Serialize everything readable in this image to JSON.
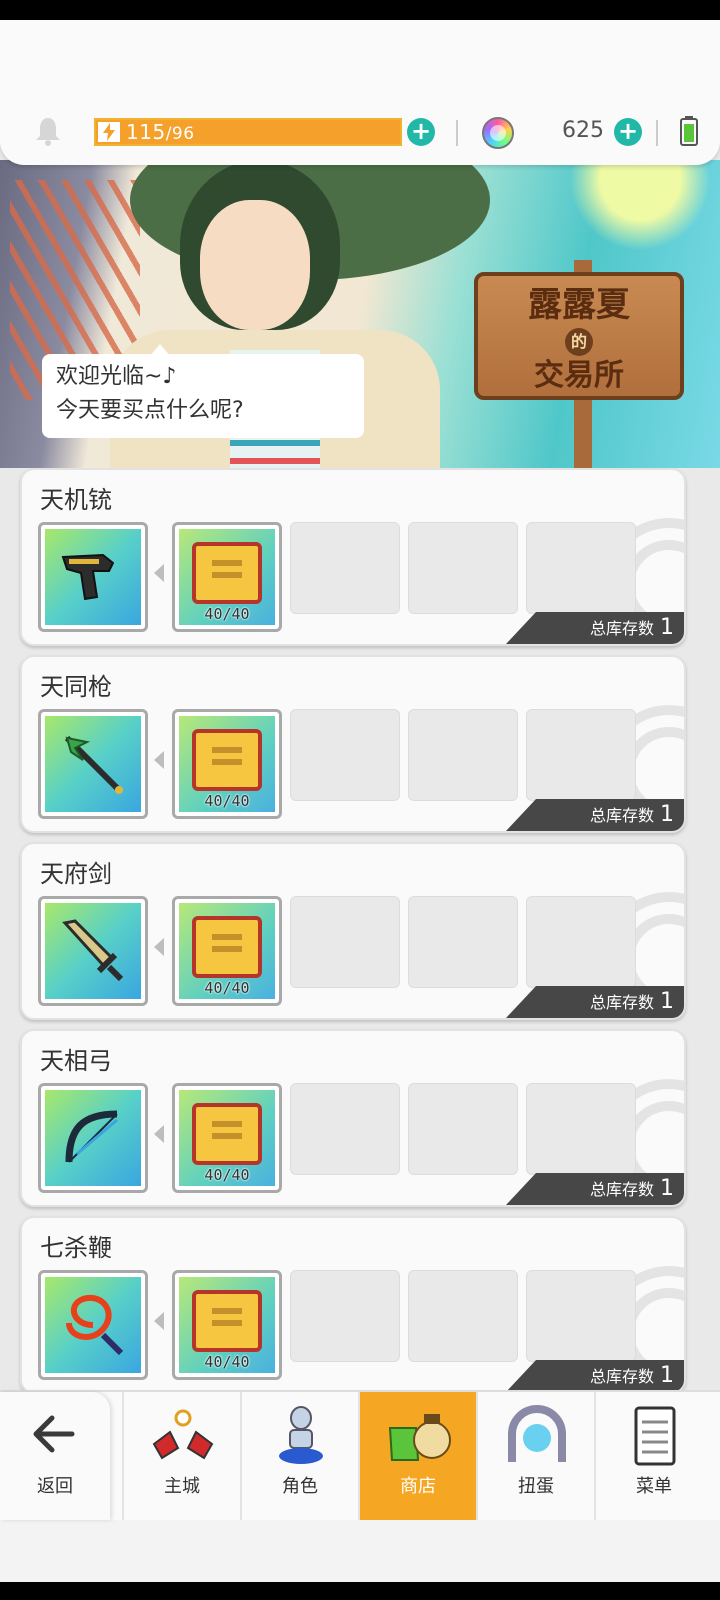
{
  "top_bar": {
    "energy_current": "115",
    "energy_max": "/96",
    "energy_fill": 1.0,
    "gem_count": "625"
  },
  "banner": {
    "speech_line1": "欢迎光临~♪",
    "speech_line2": "今天要买点什么呢?",
    "sign_line1": "露露夏",
    "sign_de": "的",
    "sign_line2": "交易所"
  },
  "shop": {
    "stock_label": "总库存数",
    "items": [
      {
        "name": "天机铳",
        "cost": "40/40",
        "stock": "1"
      },
      {
        "name": "天同枪",
        "cost": "40/40",
        "stock": "1"
      },
      {
        "name": "天府剑",
        "cost": "40/40",
        "stock": "1"
      },
      {
        "name": "天相弓",
        "cost": "40/40",
        "stock": "1"
      },
      {
        "name": "七杀鞭",
        "cost": "40/40",
        "stock": "1"
      }
    ]
  },
  "bottom_nav": {
    "back": "返回",
    "items": [
      {
        "label": "主城",
        "active": false
      },
      {
        "label": "角色",
        "active": false
      },
      {
        "label": "商店",
        "active": true
      },
      {
        "label": "扭蛋",
        "active": false
      },
      {
        "label": "菜单",
        "active": false
      }
    ]
  },
  "colors": {
    "accent_orange": "#f5a623",
    "plus_teal": "#22b8a8",
    "stock_tag": "#474747"
  }
}
